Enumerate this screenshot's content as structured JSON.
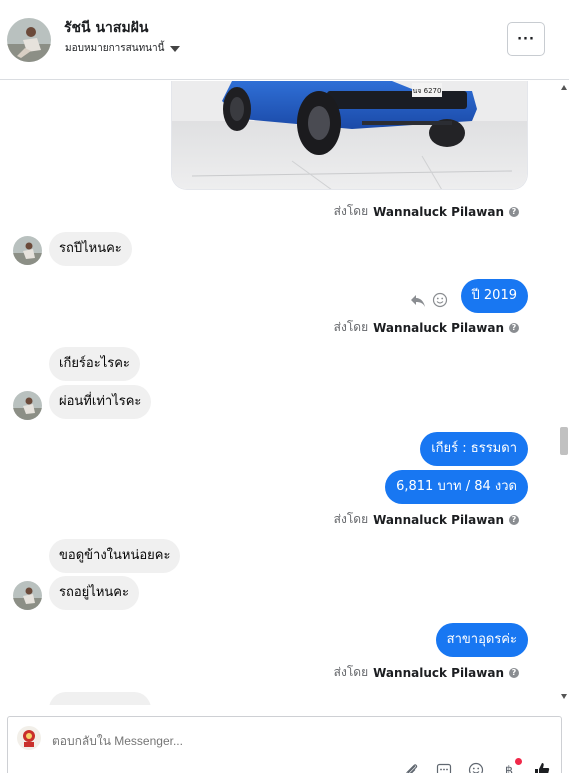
{
  "header": {
    "name": "รัชนี นาสมฝัน",
    "assign_label": "มอบหมายการสนทนานี้",
    "more_label": "···"
  },
  "messages": {
    "sent_by_prefix": "ส่งโดย",
    "sender_name": "Wannaluck Pilawan",
    "help": "?",
    "incoming": [
      "รถปีไหนคะ",
      "เกียร์อะไรคะ",
      "ผ่อนที่เท่าไรคะ",
      "ขอดูข้างในหน่อยคะ",
      "รถอยู่ไหนคะ"
    ],
    "outgoing": [
      "ปี  2019",
      "เกียร์ : ธรรมดา",
      "6,811 บาท     / 84 งวด",
      "สาขาอุดรค่ะ"
    ]
  },
  "photo": {
    "plate_text": "นจ 6270"
  },
  "composer": {
    "placeholder": "ตอบกลับใน Messenger..."
  },
  "icons": {
    "more": "more-horizontal-icon",
    "reply": "reply-icon",
    "react": "smiley-icon",
    "attach": "paperclip-icon",
    "saved": "saved-reply-icon",
    "emoji": "emoji-icon",
    "payment": "baht-icon",
    "like": "thumbs-up-icon"
  },
  "colors": {
    "brand_blue": "#1877f2",
    "incoming_bubble": "#f0f0f0",
    "notification_dot": "#f02849"
  }
}
